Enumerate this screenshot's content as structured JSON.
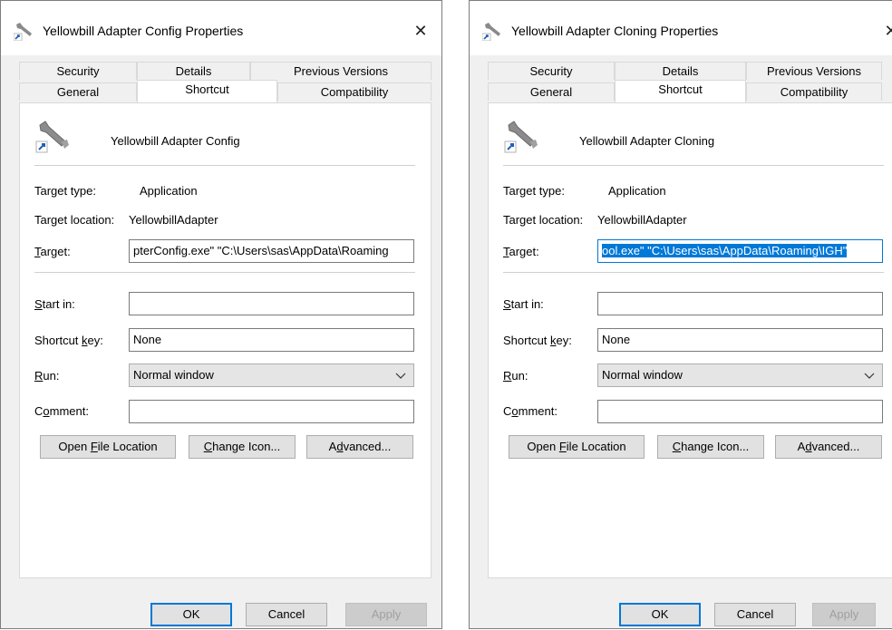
{
  "dialogs": [
    {
      "title": "Yellowbill Adapter Config Properties",
      "close_symbol": "✕",
      "tabs_row1": [
        "Security",
        "Details",
        "Previous Versions"
      ],
      "tabs_row2": [
        "General",
        "Shortcut",
        "Compatibility"
      ],
      "app_name": "Yellowbill Adapter Config",
      "target_type_label": "Target type:",
      "target_type_value": "Application",
      "target_location_label": "Target location:",
      "target_location_value": "YellowbillAdapter",
      "target_label": "Target:",
      "target_value": "pterConfig.exe\" \"C:\\Users\\sas\\AppData\\Roaming",
      "target_selected": false,
      "start_in_label": "Start in:",
      "start_in_value": "",
      "shortcut_key_label": "Shortcut key:",
      "shortcut_key_value": "None",
      "run_label": "Run:",
      "run_value": "Normal window",
      "comment_label": "Comment:",
      "comment_value": "",
      "open_file_location": "Open File Location",
      "change_icon": "Change Icon...",
      "advanced": "Advanced...",
      "ok": "OK",
      "cancel": "Cancel",
      "apply": "Apply"
    },
    {
      "title": "Yellowbill Adapter Cloning Properties",
      "close_symbol": "✕",
      "tabs_row1": [
        "Security",
        "Details",
        "Previous Versions"
      ],
      "tabs_row2": [
        "General",
        "Shortcut",
        "Compatibility"
      ],
      "app_name": "Yellowbill Adapter Cloning",
      "target_type_label": "Target type:",
      "target_type_value": "Application",
      "target_location_label": "Target location:",
      "target_location_value": "YellowbillAdapter",
      "target_label": "Target:",
      "target_value": "ool.exe\" \"C:\\Users\\sas\\AppData\\Roaming\\IGH\"",
      "target_selected": true,
      "start_in_label": "Start in:",
      "start_in_value": "",
      "shortcut_key_label": "Shortcut key:",
      "shortcut_key_value": "None",
      "run_label": "Run:",
      "run_value": "Normal window",
      "comment_label": "Comment:",
      "comment_value": "",
      "open_file_location": "Open File Location",
      "change_icon": "Change Icon...",
      "advanced": "Advanced...",
      "ok": "OK",
      "cancel": "Cancel",
      "apply": "Apply"
    }
  ],
  "colors": {
    "accent": "#0078d7",
    "dialog_bg": "#f0f0f0",
    "panel_bg": "#ffffff"
  },
  "icons": {
    "title_icon": "wrench-shortcut-icon",
    "app_icon": "wrench-shortcut-icon",
    "close_icon": "close-icon",
    "dropdown_icon": "chevron-down-icon"
  }
}
